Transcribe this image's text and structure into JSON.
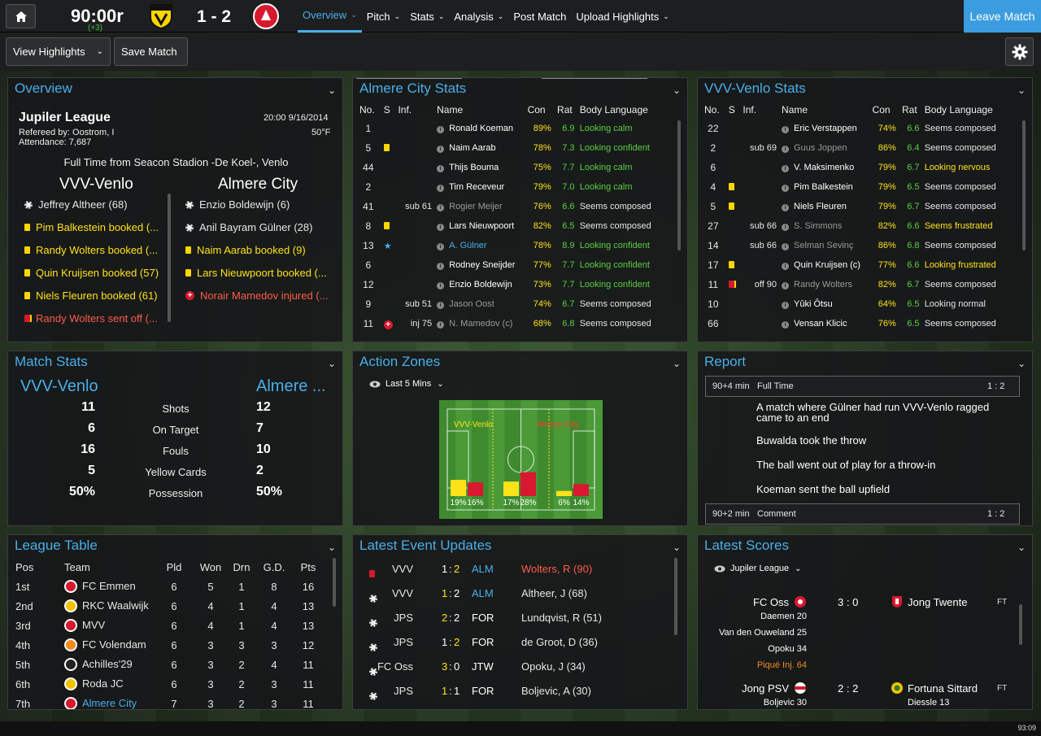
{
  "header": {
    "clock": "90:00r",
    "added_time": "(+3)",
    "score": "1 - 2",
    "nav": [
      {
        "label": "Overview",
        "chevron": true
      },
      {
        "label": "Pitch",
        "chevron": true
      },
      {
        "label": "Stats",
        "chevron": true
      },
      {
        "label": "Analysis",
        "chevron": true
      },
      {
        "label": "Post Match",
        "chevron": false
      },
      {
        "label": "Upload Highlights",
        "chevron": true
      }
    ],
    "leave": "Leave Match"
  },
  "toolbar": {
    "view_highlights": "View Highlights",
    "save_match": "Save Match"
  },
  "overview": {
    "title": "Overview",
    "league": "Jupiler League",
    "datetime": "20:00 9/16/2014",
    "referee": "Refereed by: Oostrom, I",
    "temp": "50°F",
    "attendance": "Attendance: 7,687",
    "result": "Full Time from Seacon Stadion -De Koel-, Venlo",
    "home_team": "VVV-Venlo",
    "away_team": "Almere City",
    "home_events": [
      {
        "icon": "goal",
        "text": "Jeffrey Altheer (68)",
        "color": "white"
      },
      {
        "icon": "yellow",
        "text": "Pim Balkestein booked (...",
        "color": "yellow"
      },
      {
        "icon": "yellow",
        "text": "Randy Wolters booked (...",
        "color": "yellow"
      },
      {
        "icon": "yellow",
        "text": "Quin Kruijsen booked (57)",
        "color": "yellow"
      },
      {
        "icon": "yellow",
        "text": "Niels Fleuren booked (61)",
        "color": "yellow"
      },
      {
        "icon": "red",
        "text": "Randy Wolters sent off (...",
        "color": "red"
      }
    ],
    "away_events": [
      {
        "icon": "goal",
        "text": "Enzio Boldewijn (6)",
        "color": "white"
      },
      {
        "icon": "goal",
        "text": "Anil Bayram Gülner (28)",
        "color": "white"
      },
      {
        "icon": "yellow",
        "text": "Naim Aarab booked (9)",
        "color": "yellow"
      },
      {
        "icon": "yellow",
        "text": "Lars Nieuwpoort booked (...",
        "color": "yellow"
      },
      {
        "icon": "injury",
        "text": "Norair Mamedov injured (...",
        "color": "red"
      }
    ]
  },
  "almere_stats": {
    "title": "Almere City Stats",
    "columns": [
      "No.",
      "S",
      "Inf.",
      "Name",
      "Con",
      "Rat",
      "Body Language"
    ],
    "rows": [
      {
        "no": "1",
        "s": "",
        "inf": "",
        "name": "Ronald Koeman",
        "con": "89%",
        "rat": "6.9",
        "bl": "Looking calm",
        "bl_color": "green",
        "dim": false
      },
      {
        "no": "5",
        "s": "yellow",
        "inf": "",
        "name": "Naim Aarab",
        "con": "78%",
        "rat": "7.3",
        "bl": "Looking confident",
        "bl_color": "green",
        "dim": false
      },
      {
        "no": "44",
        "s": "",
        "inf": "",
        "name": "Thijs Bouma",
        "con": "75%",
        "rat": "7.7",
        "bl": "Looking calm",
        "bl_color": "green",
        "dim": false
      },
      {
        "no": "2",
        "s": "",
        "inf": "",
        "name": "Tim Receveur",
        "con": "79%",
        "rat": "7.0",
        "bl": "Looking calm",
        "bl_color": "green",
        "dim": false
      },
      {
        "no": "41",
        "s": "",
        "inf": "sub 61",
        "name": "Rogier Meijer",
        "con": "76%",
        "rat": "6.6",
        "bl": "Seems composed",
        "bl_color": "white",
        "dim": true
      },
      {
        "no": "8",
        "s": "yellow",
        "inf": "",
        "name": "Lars Nieuwpoort",
        "con": "82%",
        "rat": "6.5",
        "bl": "Seems composed",
        "bl_color": "white",
        "dim": false
      },
      {
        "no": "13",
        "s": "star",
        "inf": "",
        "name": "A. Gülner",
        "con": "78%",
        "rat": "8.9",
        "bl": "Looking confident",
        "bl_color": "green",
        "dim": false,
        "highlight": true
      },
      {
        "no": "6",
        "s": "",
        "inf": "",
        "name": "Rodney Sneijder",
        "con": "77%",
        "rat": "7.7",
        "bl": "Looking confident",
        "bl_color": "green",
        "dim": false
      },
      {
        "no": "12",
        "s": "",
        "inf": "",
        "name": "Enzio Boldewijn",
        "con": "73%",
        "rat": "7.7",
        "bl": "Looking confident",
        "bl_color": "green",
        "dim": false
      },
      {
        "no": "9",
        "s": "",
        "inf": "sub 51",
        "name": "Jason Oost",
        "con": "74%",
        "rat": "6.7",
        "bl": "Seems composed",
        "bl_color": "white",
        "dim": true
      },
      {
        "no": "11",
        "s": "injury",
        "inf": "inj 75",
        "name": "N. Mamedov (c)",
        "con": "68%",
        "rat": "6.8",
        "bl": "Seems composed",
        "bl_color": "white",
        "dim": true
      }
    ]
  },
  "vvv_stats": {
    "title": "VVV-Venlo Stats",
    "columns": [
      "No.",
      "S",
      "Inf.",
      "Name",
      "Con",
      "Rat",
      "Body Language"
    ],
    "rows": [
      {
        "no": "22",
        "s": "",
        "inf": "",
        "name": "Eric Verstappen",
        "con": "74%",
        "rat": "6.6",
        "bl": "Seems composed",
        "bl_color": "white",
        "dim": false
      },
      {
        "no": "2",
        "s": "",
        "inf": "sub 69",
        "name": "Guus Joppen",
        "con": "86%",
        "rat": "6.4",
        "bl": "Seems composed",
        "bl_color": "white",
        "dim": true
      },
      {
        "no": "6",
        "s": "",
        "inf": "",
        "name": "V. Maksimenko",
        "con": "79%",
        "rat": "6.7",
        "bl": "Looking nervous",
        "bl_color": "yellow",
        "dim": false
      },
      {
        "no": "4",
        "s": "yellow",
        "inf": "",
        "name": "Pim Balkestein",
        "con": "79%",
        "rat": "6.5",
        "bl": "Seems composed",
        "bl_color": "white",
        "dim": false
      },
      {
        "no": "5",
        "s": "yellow",
        "inf": "",
        "name": "Niels Fleuren",
        "con": "79%",
        "rat": "6.7",
        "bl": "Seems composed",
        "bl_color": "white",
        "dim": false
      },
      {
        "no": "27",
        "s": "",
        "inf": "sub 66",
        "name": "S. Simmons",
        "con": "82%",
        "rat": "6.6",
        "bl": "Seems frustrated",
        "bl_color": "yellow",
        "dim": true
      },
      {
        "no": "14",
        "s": "",
        "inf": "sub 66",
        "name": "Selman Sevinç",
        "con": "86%",
        "rat": "6.8",
        "bl": "Seems composed",
        "bl_color": "white",
        "dim": true
      },
      {
        "no": "17",
        "s": "yellow",
        "inf": "",
        "name": "Quin Kruijsen (c)",
        "con": "77%",
        "rat": "6.6",
        "bl": "Looking frustrated",
        "bl_color": "yellow",
        "dim": false
      },
      {
        "no": "11",
        "s": "red",
        "inf": "off 90",
        "name": "Randy Wolters",
        "con": "82%",
        "rat": "6.7",
        "bl": "Seems composed",
        "bl_color": "white",
        "dim": true
      },
      {
        "no": "10",
        "s": "",
        "inf": "",
        "name": "Yûki Ôtsu",
        "con": "64%",
        "rat": "6.5",
        "bl": "Looking normal",
        "bl_color": "white",
        "dim": false
      },
      {
        "no": "66",
        "s": "",
        "inf": "",
        "name": "Vensan Klicic",
        "con": "76%",
        "rat": "6.5",
        "bl": "Seems composed",
        "bl_color": "white",
        "dim": false
      }
    ]
  },
  "match_stats": {
    "title": "Match Stats",
    "home": "VVV-Venlo",
    "away": "Almere ...",
    "rows": [
      {
        "label": "Shots",
        "home": "11",
        "away": "12"
      },
      {
        "label": "On Target",
        "home": "6",
        "away": "7"
      },
      {
        "label": "Fouls",
        "home": "16",
        "away": "10"
      },
      {
        "label": "Yellow Cards",
        "home": "5",
        "away": "2"
      },
      {
        "label": "Possession",
        "home": "50%",
        "away": "50%"
      }
    ]
  },
  "action_zones": {
    "title": "Action Zones",
    "filter": "Last 5 Mins",
    "home_label": "VVV-Venlo",
    "away_label": "Almere City",
    "home_color": "#ffe21a",
    "away_color": "#d8182f",
    "zones": [
      {
        "home": 19,
        "away": 16,
        "home_label": "19%",
        "away_label": "16%"
      },
      {
        "home": 17,
        "away": 28,
        "home_label": "17%",
        "away_label": "28%"
      },
      {
        "home": 6,
        "away": 14,
        "home_label": "6%",
        "away_label": "14%"
      }
    ]
  },
  "report": {
    "title": "Report",
    "entries": [
      {
        "time": "90+4 min",
        "type": "Full Time",
        "score": "1 : 2"
      },
      {
        "time": "90+2 min",
        "type": "Comment",
        "score": "1 : 2"
      }
    ],
    "lines": [
      "A match where Gülner had run VVV-Venlo ragged came to an end",
      "Buwalda took the throw",
      "The ball went out of play for a throw-in",
      "Koeman sent the ball upfield"
    ]
  },
  "league_table": {
    "title": "League Table",
    "columns": [
      "Pos",
      "Team",
      "Pld",
      "Won",
      "Drn",
      "G.D.",
      "Pts"
    ],
    "rows": [
      {
        "pos": "1st",
        "team": "FC Emmen",
        "pld": "6",
        "won": "5",
        "drn": "1",
        "gd": "8",
        "pts": "16",
        "color": "#d8182f"
      },
      {
        "pos": "2nd",
        "team": "RKC Waalwijk",
        "pld": "6",
        "won": "4",
        "drn": "1",
        "gd": "4",
        "pts": "13",
        "color": "#f2c200"
      },
      {
        "pos": "3rd",
        "team": "MVV",
        "pld": "6",
        "won": "4",
        "drn": "1",
        "gd": "4",
        "pts": "13",
        "color": "#d8182f"
      },
      {
        "pos": "4th",
        "team": "FC Volendam",
        "pld": "6",
        "won": "3",
        "drn": "3",
        "gd": "3",
        "pts": "12",
        "color": "#f28c1e"
      },
      {
        "pos": "5th",
        "team": "Achilles'29",
        "pld": "6",
        "won": "3",
        "drn": "2",
        "gd": "4",
        "pts": "11",
        "color": "#222222"
      },
      {
        "pos": "6th",
        "team": "Roda JC",
        "pld": "6",
        "won": "3",
        "drn": "2",
        "gd": "3",
        "pts": "11",
        "color": "#f2c200"
      },
      {
        "pos": "7th",
        "team": "Almere City",
        "pld": "7",
        "won": "3",
        "drn": "2",
        "gd": "3",
        "pts": "11",
        "color": "#d8182f"
      }
    ]
  },
  "latest_events": {
    "title": "Latest Event Updates",
    "rows": [
      {
        "icon": "red",
        "home": "VVV",
        "hs": "1",
        "as": "2",
        "away": "ALM",
        "player": "Wolters, R (90)",
        "player_color": "red",
        "hl": "away"
      },
      {
        "icon": "goal",
        "home": "VVV",
        "hs": "1",
        "as": "2",
        "away": "ALM",
        "player": "Altheer, J (68)",
        "player_color": "white",
        "hl": "home"
      },
      {
        "icon": "goal",
        "home": "JPS",
        "hs": "2",
        "as": "2",
        "away": "FOR",
        "player": "Lundqvist, R (51)",
        "player_color": "white",
        "hl": "home"
      },
      {
        "icon": "goal",
        "home": "JPS",
        "hs": "1",
        "as": "2",
        "away": "FOR",
        "player": "de Groot, D (36)",
        "player_color": "white",
        "hl": "away"
      },
      {
        "icon": "goal",
        "home": "FC Oss",
        "hs": "3",
        "as": "0",
        "away": "JTW",
        "player": "Opoku, J (34)",
        "player_color": "white",
        "hl": "home"
      },
      {
        "icon": "goal",
        "home": "JPS",
        "hs": "1",
        "as": "1",
        "away": "FOR",
        "player": "Boljevic, A (30)",
        "player_color": "white",
        "hl": "home"
      }
    ]
  },
  "latest_scores": {
    "title": "Latest Scores",
    "filter": "Jupiler League",
    "matches": [
      {
        "home": "FC Oss",
        "score": "3 : 0",
        "away": "Jong Twente",
        "status": "FT",
        "scorers": [
          {
            "text": "Daemen 20",
            "color": "white"
          },
          {
            "text": "Van den Ouweland 25",
            "color": "white"
          },
          {
            "text": "Opoku 34",
            "color": "white"
          },
          {
            "text": "Piqué Inj. 64",
            "color": "orange"
          }
        ]
      },
      {
        "home": "Jong PSV",
        "score": "2 : 2",
        "away": "Fortuna Sittard",
        "status": "FT",
        "scorers_home": "Boljevic 30",
        "scorers_away": "Diessle 13"
      }
    ]
  },
  "status_time": "93:09"
}
